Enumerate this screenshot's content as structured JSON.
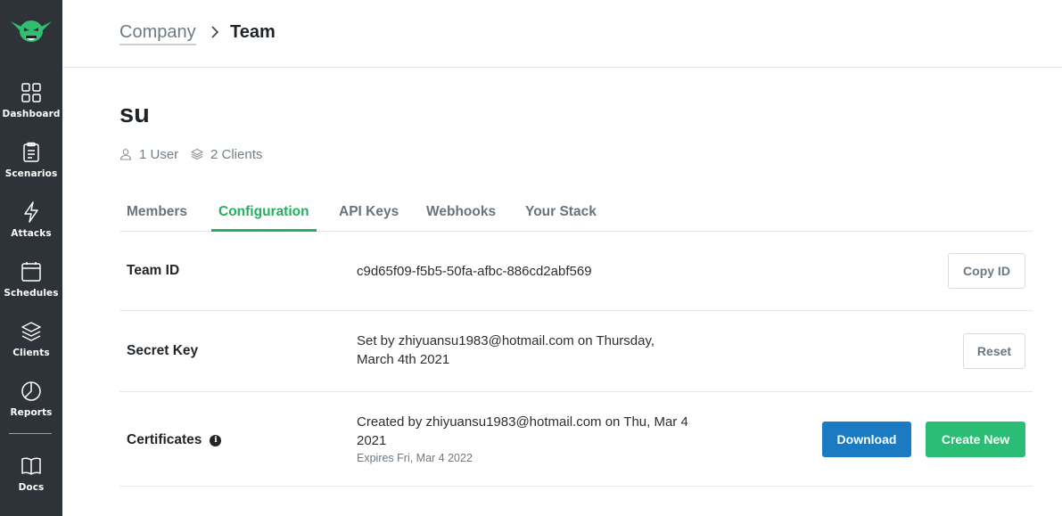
{
  "sidebar": {
    "logo": "goblin-logo",
    "items": [
      {
        "label": "Dashboard",
        "icon": "dashboard-grid-icon"
      },
      {
        "label": "Scenarios",
        "icon": "clipboard-icon"
      },
      {
        "label": "Attacks",
        "icon": "lightning-icon"
      },
      {
        "label": "Schedules",
        "icon": "calendar-icon"
      },
      {
        "label": "Clients",
        "icon": "layers-icon"
      },
      {
        "label": "Reports",
        "icon": "pie-chart-icon"
      },
      {
        "label": "Docs",
        "icon": "book-icon"
      }
    ]
  },
  "breadcrumb": {
    "parent": "Company",
    "current": "Team"
  },
  "team": {
    "name": "su",
    "users": "1 User",
    "clients": "2 Clients"
  },
  "tabs": [
    {
      "label": "Members"
    },
    {
      "label": "Configuration",
      "active": true
    },
    {
      "label": "API Keys"
    },
    {
      "label": "Webhooks"
    },
    {
      "label": "Your Stack"
    }
  ],
  "config": {
    "team_id": {
      "label": "Team ID",
      "value": "c9d65f09-f5b5-50fa-afbc-886cd2abf569",
      "button": "Copy ID"
    },
    "secret_key": {
      "label": "Secret Key",
      "value": "Set by zhiyuansu1983@hotmail.com on Thursday, March 4th 2021",
      "button": "Reset"
    },
    "certificates": {
      "label": "Certificates",
      "value": "Created by zhiyuansu1983@hotmail.com on Thu, Mar 4 2021",
      "expires": "Expires Fri, Mar 4 2022",
      "download_button": "Download",
      "create_button": "Create New"
    }
  },
  "colors": {
    "sidebar_bg": "#2d3338",
    "accent_green": "#27ae60",
    "button_blue": "#1a7bc2",
    "button_green": "#2bbd73"
  }
}
